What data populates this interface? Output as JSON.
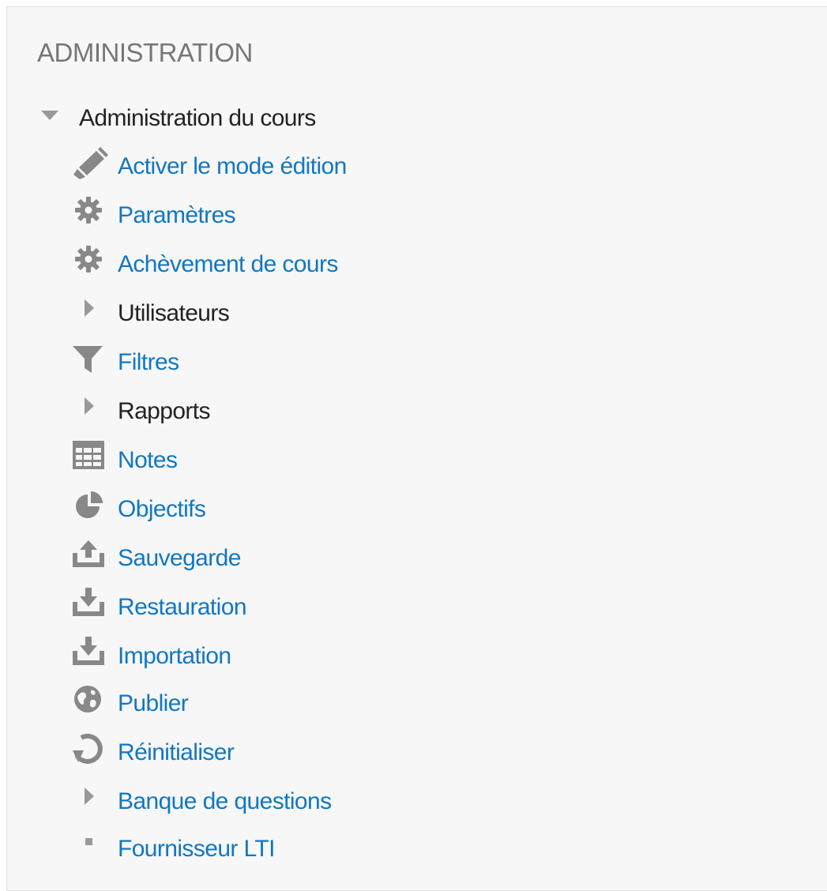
{
  "block": {
    "title": "ADMINISTRATION"
  },
  "tree": {
    "root": {
      "label": "Administration du cours",
      "expanded": true
    },
    "items": [
      {
        "label": "Activer le mode édition",
        "icon": "pencil-icon",
        "is_link": true
      },
      {
        "label": "Paramètres",
        "icon": "gear-icon",
        "is_link": true
      },
      {
        "label": "Achèvement de cours",
        "icon": "gear-icon",
        "is_link": true
      },
      {
        "label": "Utilisateurs",
        "icon": "caret-right-icon",
        "is_link": false,
        "expandable": true
      },
      {
        "label": "Filtres",
        "icon": "filter-icon",
        "is_link": true
      },
      {
        "label": "Rapports",
        "icon": "caret-right-icon",
        "is_link": false,
        "expandable": true
      },
      {
        "label": "Notes",
        "icon": "gradebook-table-icon",
        "is_link": true
      },
      {
        "label": "Objectifs",
        "icon": "pie-chart-icon",
        "is_link": true
      },
      {
        "label": "Sauvegarde",
        "icon": "upload-icon",
        "is_link": true
      },
      {
        "label": "Restauration",
        "icon": "download-icon",
        "is_link": true
      },
      {
        "label": "Importation",
        "icon": "download-icon",
        "is_link": true
      },
      {
        "label": "Publier",
        "icon": "globe-icon",
        "is_link": true
      },
      {
        "label": "Réinitialiser",
        "icon": "refresh-icon",
        "is_link": true
      },
      {
        "label": "Banque de questions",
        "icon": "caret-right-icon",
        "is_link": true,
        "expandable": true
      },
      {
        "label": "Fournisseur LTI",
        "icon": "bullet-icon",
        "is_link": true
      }
    ]
  },
  "colors": {
    "link": "#1177c3",
    "text": "#222222",
    "heading": "#777777",
    "icon": "#888888",
    "caret": "#999999",
    "panel_bg": "#f7f7f7",
    "panel_border": "#dedede"
  }
}
